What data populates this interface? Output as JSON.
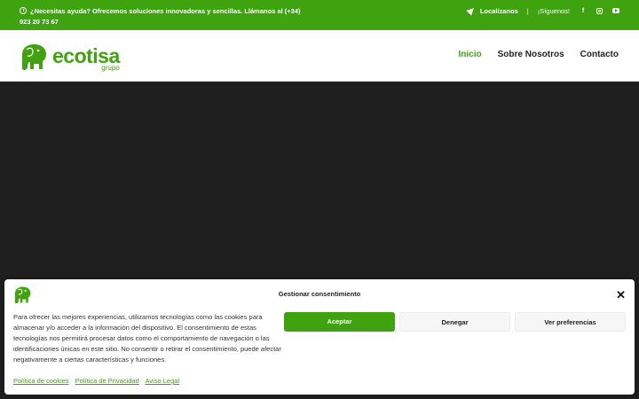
{
  "colors": {
    "brand_green": "#3fa30f",
    "hero_bg": "#1f1f1f",
    "text_dark": "#222222"
  },
  "topbar": {
    "help_text": "¿Necesitas ayuda? Ofrecemos soluciones innovadoras y sencillas. Llámanos al (+34) 923 20 73 67",
    "location_label": "Localízanos",
    "separator": "|",
    "follow_label": "¡Síguenos!",
    "social": {
      "facebook": "f"
    }
  },
  "header": {
    "logo_word": "ecotisa",
    "logo_sub": "grupo",
    "nav": [
      "Inicio",
      "Sobre Nosotros",
      "Contacto"
    ]
  },
  "cookie_banner": {
    "title": "Gestionar consentimiento",
    "close_symbol": "✕",
    "text": "Para ofrecer las mejores experiencias, utilizamos tecnologías como las cookies para almacenar y/o acceder a la información del dispositivo. El consentimiento de estas tecnologías nos permitirá procesar datos como el comportamiento de navegación o las identificaciones únicas en este sitio. No consentir o retirar el consentimiento, puede afectar negativamente a ciertas características y funciones.",
    "accept_label": "Aceptar",
    "deny_label": "Denegar",
    "prefs_label": "Ver preferencias",
    "links": [
      "Política de cookies",
      "Política de Privacidad",
      "Aviso Legal"
    ]
  }
}
